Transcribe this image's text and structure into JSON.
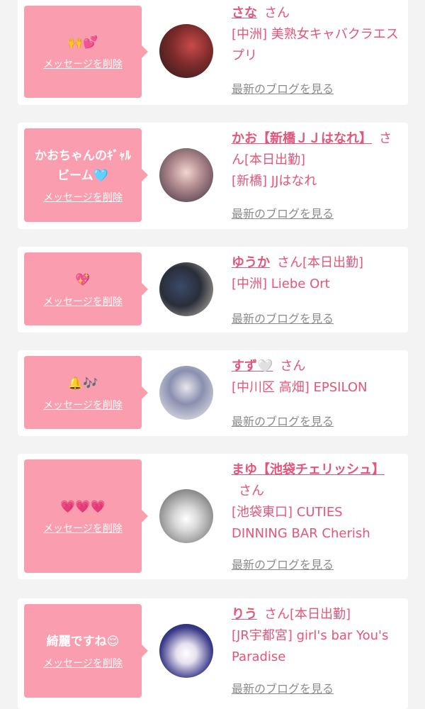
{
  "delete_label": "メッセージを削除",
  "blog_label": "最新のブログを見る",
  "cards": [
    {
      "message": "🙌💕",
      "name": "さな",
      "suffix": "さん",
      "status": "",
      "shop": "[中洲] 美熟女キャバクラエスプリ"
    },
    {
      "message": "かおちゃんのｷﾞｬﾙビーム🩵",
      "name": "かお【新橋ＪＪはなれ】",
      "suffix": "さん",
      "status": "[本日出勤]",
      "shop": "[新橋] JJはなれ"
    },
    {
      "message": "💖",
      "name": "ゆうか",
      "suffix": "さん",
      "status": "[本日出勤]",
      "shop": "[中洲] Liebe Ort"
    },
    {
      "message": "🔔🎶",
      "name": "すず🤍",
      "suffix": "さん",
      "status": "",
      "shop": "[中川区 高畑] EPSILON"
    },
    {
      "message": "💗💗💗",
      "name": "まゆ【池袋チェリッシュ】",
      "suffix": "さん",
      "status": "",
      "shop": "[池袋東口] CUTIES DINNING BAR Cherish"
    },
    {
      "message": "綺麗ですね😌",
      "name": "りう",
      "suffix": "さん",
      "status": "[本日出勤]",
      "shop": "[JR宇都宮] girl's bar You's Paradise"
    }
  ],
  "colors": {
    "page_bg": "#f3f3f3",
    "bubble_bg": "#f99daf",
    "accent_pink": "#e4557b",
    "link_gray": "#8c8c8c"
  }
}
